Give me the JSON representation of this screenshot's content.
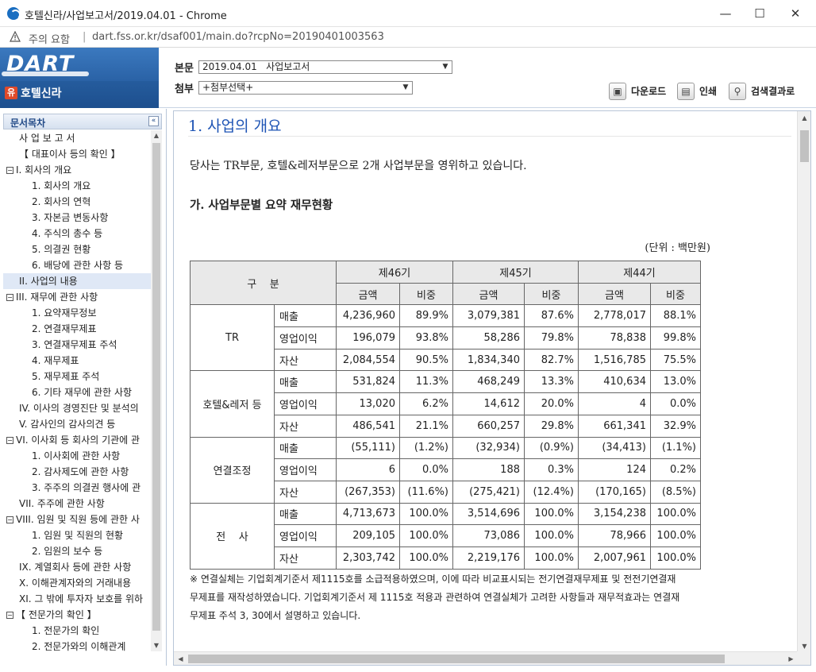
{
  "window": {
    "title": "호텔신라/사업보고서/2019.04.01 - Chrome",
    "min_glyph": "—",
    "max_glyph": "☐",
    "close_glyph": "✕"
  },
  "addressbar": {
    "warning": "주의 요함",
    "separator": "|",
    "url": "dart.fss.or.kr/dsaf001/main.do?rcpNo=20190401003563"
  },
  "header": {
    "logo": "DART",
    "company_badge": "유",
    "company": "호텔신라",
    "bonmun_label": "본문",
    "bonmun_value": "2019.04.01   사업보고서",
    "cheombu_label": "첨부",
    "cheombu_value": "+첨부선택+",
    "download_label": "다운로드",
    "print_label": "인쇄",
    "search_label": "검색결과로"
  },
  "sidebar": {
    "title": "문서목차",
    "collapse_glyph": "«",
    "items": [
      {
        "label": "사 업 보 고 서",
        "indent": 1,
        "exp": ""
      },
      {
        "label": "【 대표이사 등의 확인 】",
        "indent": 1,
        "exp": ""
      },
      {
        "label": "I. 회사의 개요",
        "indent": 0,
        "exp": "−"
      },
      {
        "label": "1. 회사의 개요",
        "indent": 2,
        "exp": ""
      },
      {
        "label": "2. 회사의 연혁",
        "indent": 2,
        "exp": ""
      },
      {
        "label": "3. 자본금 변동사항",
        "indent": 2,
        "exp": ""
      },
      {
        "label": "4. 주식의 총수 등",
        "indent": 2,
        "exp": ""
      },
      {
        "label": "5. 의결권 현황",
        "indent": 2,
        "exp": ""
      },
      {
        "label": "6. 배당에 관한 사항 등",
        "indent": 2,
        "exp": ""
      },
      {
        "label": "II. 사업의 내용",
        "indent": 1,
        "exp": "",
        "selected": true
      },
      {
        "label": "III. 재무에 관한 사항",
        "indent": 0,
        "exp": "−"
      },
      {
        "label": "1. 요약재무정보",
        "indent": 2,
        "exp": ""
      },
      {
        "label": "2. 연결재무제표",
        "indent": 2,
        "exp": ""
      },
      {
        "label": "3. 연결재무제표 주석",
        "indent": 2,
        "exp": ""
      },
      {
        "label": "4. 재무제표",
        "indent": 2,
        "exp": ""
      },
      {
        "label": "5. 재무제표 주석",
        "indent": 2,
        "exp": ""
      },
      {
        "label": "6. 기타 재무에 관한 사항",
        "indent": 2,
        "exp": ""
      },
      {
        "label": "IV. 이사의 경영진단 및 분석의",
        "indent": 1,
        "exp": ""
      },
      {
        "label": "V. 감사인의 감사의견 등",
        "indent": 1,
        "exp": ""
      },
      {
        "label": "VI. 이사회 등 회사의 기관에 관",
        "indent": 0,
        "exp": "−"
      },
      {
        "label": "1. 이사회에 관한 사항",
        "indent": 2,
        "exp": ""
      },
      {
        "label": "2. 감사제도에 관한 사항",
        "indent": 2,
        "exp": ""
      },
      {
        "label": "3. 주주의 의결권 행사에 관",
        "indent": 2,
        "exp": ""
      },
      {
        "label": "VII. 주주에 관한 사항",
        "indent": 1,
        "exp": ""
      },
      {
        "label": "VIII. 임원 및 직원 등에 관한 사",
        "indent": 0,
        "exp": "−"
      },
      {
        "label": "1. 임원 및 직원의 현황",
        "indent": 2,
        "exp": ""
      },
      {
        "label": "2. 임원의 보수 등",
        "indent": 2,
        "exp": ""
      },
      {
        "label": "IX. 계열회사 등에 관한 사항",
        "indent": 1,
        "exp": ""
      },
      {
        "label": "X. 이해관계자와의 거래내용",
        "indent": 1,
        "exp": ""
      },
      {
        "label": "XI. 그 밖에 투자자 보호를 위하",
        "indent": 1,
        "exp": ""
      },
      {
        "label": "【 전문가의 확인 】",
        "indent": 0,
        "exp": "−"
      },
      {
        "label": "1. 전문가의 확인",
        "indent": 2,
        "exp": ""
      },
      {
        "label": "2. 전문가와의 이해관계",
        "indent": 2,
        "exp": ""
      }
    ]
  },
  "document": {
    "section_title": "1. 사업의 개요",
    "intro": "당사는 TR부문, 호텔&레저부문으로 2개 사업부문을 영위하고 있습니다.",
    "subsection_title": "가. 사업부문별 요약 재무현황",
    "unit": "(단위 : 백만원)",
    "table": {
      "corner": "구    분",
      "periods": [
        "제46기",
        "제45기",
        "제44기"
      ],
      "sub_headers": [
        "금액",
        "비중",
        "금액",
        "비중",
        "금액",
        "비중"
      ],
      "segments": [
        {
          "name": "TR",
          "rows": [
            {
              "item": "매출",
              "values": [
                "4,236,960",
                "89.9%",
                "3,079,381",
                "87.6%",
                "2,778,017",
                "88.1%"
              ]
            },
            {
              "item": "영업이익",
              "values": [
                "196,079",
                "93.8%",
                "58,286",
                "79.8%",
                "78,838",
                "99.8%"
              ]
            },
            {
              "item": "자산",
              "values": [
                "2,084,554",
                "90.5%",
                "1,834,340",
                "82.7%",
                "1,516,785",
                "75.5%"
              ]
            }
          ]
        },
        {
          "name": "호텔&레저 등",
          "rows": [
            {
              "item": "매출",
              "values": [
                "531,824",
                "11.3%",
                "468,249",
                "13.3%",
                "410,634",
                "13.0%"
              ]
            },
            {
              "item": "영업이익",
              "values": [
                "13,020",
                "6.2%",
                "14,612",
                "20.0%",
                "4",
                "0.0%"
              ]
            },
            {
              "item": "자산",
              "values": [
                "486,541",
                "21.1%",
                "660,257",
                "29.8%",
                "661,341",
                "32.9%"
              ]
            }
          ]
        },
        {
          "name": "연결조정",
          "rows": [
            {
              "item": "매출",
              "values": [
                "(55,111)",
                "(1.2%)",
                "(32,934)",
                "(0.9%)",
                "(34,413)",
                "(1.1%)"
              ]
            },
            {
              "item": "영업이익",
              "values": [
                "6",
                "0.0%",
                "188",
                "0.3%",
                "124",
                "0.2%"
              ]
            },
            {
              "item": "자산",
              "values": [
                "(267,353)",
                "(11.6%)",
                "(275,421)",
                "(12.4%)",
                "(170,165)",
                "(8.5%)"
              ]
            }
          ]
        },
        {
          "name": "전    사",
          "rows": [
            {
              "item": "매출",
              "values": [
                "4,713,673",
                "100.0%",
                "3,514,696",
                "100.0%",
                "3,154,238",
                "100.0%"
              ]
            },
            {
              "item": "영업이익",
              "values": [
                "209,105",
                "100.0%",
                "73,086",
                "100.0%",
                "78,966",
                "100.0%"
              ]
            },
            {
              "item": "자산",
              "values": [
                "2,303,742",
                "100.0%",
                "2,219,176",
                "100.0%",
                "2,007,961",
                "100.0%"
              ]
            }
          ]
        }
      ]
    },
    "note": "※ 연결실체는 기업회계기준서 제1115호를 소급적용하였으며, 이에 따라 비교표시되는 전기연결재무제표 및 전전기연결재무제표를 재작성하였습니다. 기업회계기준서 제 1115호 적용과 관련하여 연결실체가 고려한 사항들과 재무적효과는 연결재무제표 주석 3, 30에서 설명하고 있습니다."
  }
}
